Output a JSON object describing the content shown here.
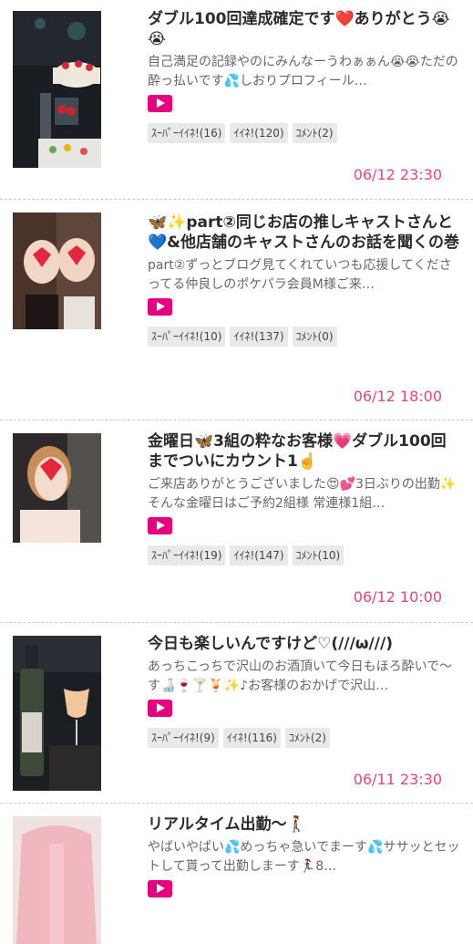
{
  "posts": [
    {
      "title": "ダブル100回達成確定です❤️ありがとう😭😭",
      "excerpt": "自己満足の記録やのにみんなーうわぁぁん😭😭ただの酔っ払いです💦しおりプロフィール…",
      "super_like": "ｽｰﾊﾟｰｲｲﾈ!(16)",
      "like": "ｲｲﾈ!(120)",
      "comment": "ｺﾒﾝﾄ(2)",
      "date": "06/12 23:30"
    },
    {
      "title": "🦋✨part②同じお店の推しキャストさんと💙&他店舗のキャストさんのお話を聞くの巻",
      "excerpt": "part②ずっとブログ見てくれていつも応援してくださってる仲良しのポケパラ会員M様ご来…",
      "super_like": "ｽｰﾊﾟｰｲｲﾈ!(10)",
      "like": "ｲｲﾈ!(137)",
      "comment": "ｺﾒﾝﾄ(0)",
      "date": "06/12 18:00"
    },
    {
      "title": "金曜日🦋3組の粋なお客様💗ダブル100回までついにカウント1☝️",
      "excerpt": "ご来店ありがとうございました😍💕3日ぶりの出勤✨そんな金曜日はご予約2組様 常連様1組…",
      "super_like": "ｽｰﾊﾟｰｲｲﾈ!(19)",
      "like": "ｲｲﾈ!(147)",
      "comment": "ｺﾒﾝﾄ(10)",
      "date": "06/12 10:00"
    },
    {
      "title": "今日も楽しいんですけど♡(///ω///)",
      "excerpt": "あっちこっちで沢山のお酒頂いて今日もほろ酔いで〜す🍶🍷🍸🍹✨♪お客様のおかげで沢山…",
      "super_like": "ｽｰﾊﾟｰｲｲﾈ!(9)",
      "like": "ｲｲﾈ!(116)",
      "comment": "ｺﾒﾝﾄ(2)",
      "date": "06/11 23:30"
    },
    {
      "title": "リアルタイム出勤〜🚶‍♀️",
      "excerpt": "やばいやばい💦めっちゃ急いでまーす💦ササッとセットして貰って出勤しまーす🏃‍♀️8…"
    }
  ]
}
